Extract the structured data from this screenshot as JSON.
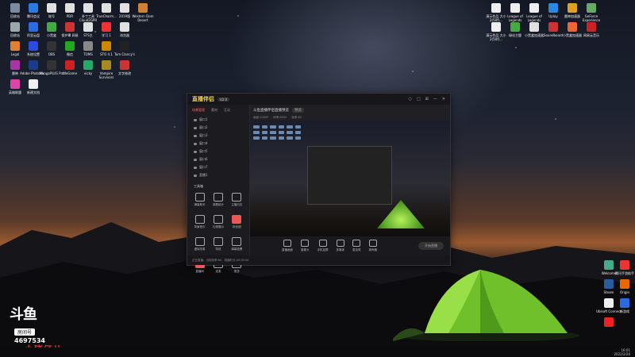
{
  "desktop": {
    "left_icons": [
      {
        "label": "回收站",
        "color": "#7a8aa0"
      },
      {
        "label": "腾讯会议",
        "color": "#2a7ae2"
      },
      {
        "label": "账号",
        "color": "#e0e0e0"
      },
      {
        "label": "PDR",
        "color": "#e0e0e0"
      },
      {
        "label": "补丁工具 Cloud2GPR",
        "color": "#e0e0e0"
      },
      {
        "label": "TrueCharm...",
        "color": "#e0e0e0"
      },
      {
        "label": "2019版",
        "color": "#e0e0e0"
      },
      {
        "label": "Western Dom Desert",
        "color": "#d08030"
      },
      {
        "label": "回收站",
        "color": "#9aa"
      },
      {
        "label": "阿里云盘",
        "color": "#2a6ae2"
      },
      {
        "label": "小黑盒",
        "color": "#4a4"
      },
      {
        "label": "保护罩 网易",
        "color": "#c33"
      },
      {
        "label": "STS主",
        "color": "#e0e0e0"
      },
      {
        "label": "学习 1",
        "color": "#e33"
      },
      {
        "label": "浏览器",
        "color": "#e0e0e0"
      },
      {
        "label": "Legal",
        "color": "#e08030"
      },
      {
        "label": "系统设置",
        "color": "#2a4ae2"
      },
      {
        "label": "OBS",
        "color": "#333"
      },
      {
        "label": "微信",
        "color": "#2a2"
      },
      {
        "label": "TOMS",
        "color": "#888"
      },
      {
        "label": "STO 4.1",
        "color": "#c80"
      },
      {
        "label": "Tom Clancy's",
        "color": "#222"
      },
      {
        "label": "雷神",
        "color": "#a3a"
      },
      {
        "label": "Adobe Photosh...",
        "color": "#1a3a8a"
      },
      {
        "label": "MangoPLUS Pro",
        "color": "#333"
      },
      {
        "label": "WeGame",
        "color": "#c22"
      },
      {
        "label": "vicky",
        "color": "#2a6"
      },
      {
        "label": "Vampire Survivors",
        "color": "#a82"
      },
      {
        "label": "文字修改",
        "color": "#c33"
      },
      {
        "label": "英雄联盟",
        "color": "#d4a"
      },
      {
        "label": "新建文档",
        "color": "#eee"
      },
      {
        "label": "新建文档",
        "color": "#eee"
      }
    ],
    "right_icons": [
      {
        "label": "演示作品 大小 2(50f)...",
        "color": "#eee"
      },
      {
        "label": "League of Legends",
        "color": "#eee"
      },
      {
        "label": "League of Legends",
        "color": "#eee"
      },
      {
        "label": "Uplay",
        "color": "#2a8ae2"
      },
      {
        "label": "雷神加速器",
        "color": "#e0a020"
      },
      {
        "label": "GeForce Experience",
        "color": "#6a6"
      },
      {
        "label": "演示作品 大小 2(50f)...",
        "color": "#eee"
      },
      {
        "label": "绿化主题",
        "color": "#4a4"
      },
      {
        "label": "小黑盒加速器",
        "color": "#e0e0e0"
      },
      {
        "label": "Soundboard",
        "color": "#c33"
      },
      {
        "label": "小黑盒加速器",
        "color": "#e63"
      },
      {
        "label": "网易云音乐",
        "color": "#c22"
      }
    ],
    "tray_icons": [
      {
        "label": "Welcome",
        "color": "#4a8"
      },
      {
        "label": "腾讯手游助手",
        "color": "#e33"
      },
      {
        "label": "Steam",
        "color": "#2a5aa0"
      },
      {
        "label": "Origin",
        "color": "#e60"
      },
      {
        "label": "Ubisoft Connect",
        "color": "#eee"
      },
      {
        "label": "新游戏",
        "color": "#2a6ae2"
      },
      {
        "label": "",
        "color": "#e22"
      }
    ],
    "clock": {
      "time": "16:01",
      "date": "2022/2/26"
    }
  },
  "obs_window": {
    "logo": "直播伴侣",
    "version_badge": "V2.0",
    "title_buttons": [
      "○",
      "□",
      "⊞",
      "—",
      "✕"
    ],
    "side_tabs": [
      "场景管理",
      "素材",
      "互动"
    ],
    "active_tab": 0,
    "scenes": [
      "窗口1",
      "窗口2",
      "窗口3",
      "窗口4",
      "窗口5",
      "窗口6",
      "窗口7",
      "直播1"
    ],
    "tools_title": "工具箱",
    "tools": [
      {
        "label": "弹幕助手",
        "hot": false
      },
      {
        "label": "观看统计",
        "hot": false
      },
      {
        "label": "主播日志",
        "hot": false
      },
      {
        "label": "背景音乐",
        "hot": false
      },
      {
        "label": "礼物展示",
        "hot": false
      },
      {
        "label": "粉丝团",
        "hot": true
      },
      {
        "label": "虚拟形象",
        "hot": false
      },
      {
        "label": "特效",
        "hot": false
      },
      {
        "label": "弹幕投票",
        "hot": false
      },
      {
        "label": "直播间",
        "hot": true
      },
      {
        "label": "连麦",
        "hot": false
      },
      {
        "label": "更多",
        "hot": false
      }
    ],
    "main_title": "斗鱼直播伴侣直播预览",
    "main_tag": "预览",
    "sub_items": [
      "画面:1080P",
      "码率:6000",
      "帧率:60"
    ],
    "controls": [
      "直播画面",
      "摄像头",
      "手机投屏",
      "多媒体",
      "麦克风",
      "扬声器"
    ],
    "live_button": "开始直播",
    "status": "正在直播，当前帧率:60，直播时长:00:00:00"
  },
  "overlay": {
    "douyu_logo": "斗鱼",
    "room_label": "房间号",
    "room_number": "4697534",
    "banner": "~~~小猪仔儿~~~~"
  }
}
